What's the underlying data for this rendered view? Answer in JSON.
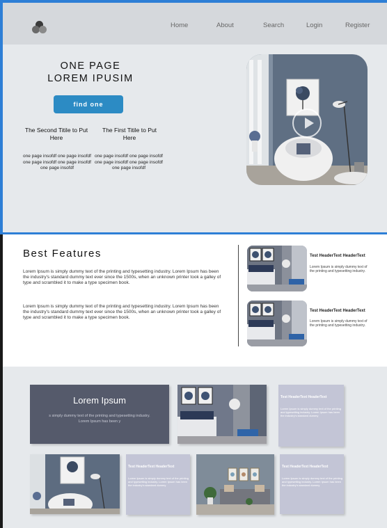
{
  "nav": {
    "items": [
      {
        "label": "Home"
      },
      {
        "label": "About"
      },
      {
        "label": "Search"
      },
      {
        "label": "Login"
      },
      {
        "label": "Register"
      }
    ]
  },
  "hero": {
    "title_line1": "ONE PAGE",
    "title_line2": "LOREM IPUSIM",
    "button_label": "find one",
    "columns": [
      {
        "title": "The Second Titile to Put Here",
        "text": "one page insofdf one page insofdf one page insofdf one page insofdf one page insofdf"
      },
      {
        "title": "The First Titile to Put Here",
        "text": "one page insofdf one page insofdf one page insofdf one page insofdf one page insofdf"
      }
    ]
  },
  "features": {
    "title": "Best Features",
    "paragraphs": [
      "Lorem Ipsum is simply dummy text of the printing and typesetting industry. Lorem Ipsum has been the industry's standard dummy text ever since the 1500s, when an unknown printer took a galley of type and scrambled it to make a type specimen book.",
      "Lorem Ipsum is simply dummy text of the printing and typesetting industry. Lorem Ipsum has been the industry's standard dummy text ever since the 1500s, when an unknown printer took a galley of type and scrambled it to make a type specimen book."
    ],
    "cards": [
      {
        "title": "Test HeaderText HeaderText",
        "text": "Lorem Ipsum is simply dummy text of the printing and typesetting industry."
      },
      {
        "title": "Test HeaderText HeaderText",
        "text": "Lorem Ipsum is simply dummy text of the printing and typesetting industry."
      }
    ]
  },
  "gallery": {
    "feature_title": "Lorem Ipsum",
    "feature_text": "s simply dummy text of the printing and typesetting industry. Lorem Ipsum has been y",
    "tiles": [
      {
        "title": "Test HeaderText HeaderText",
        "text": "Lorem Ipsum is simply dummy text of the printing and typesetting industry. Lorem Ipsum has been the industry's standard dummy"
      },
      {
        "title": "Test HeaderText HeaderText",
        "text": "Lorem Ipsum is simply dummy text of the printing and typesetting industry. Lorem Ipsum has been the industry's standard dummy"
      },
      {
        "title": "Test HeaderText HeaderText",
        "text": "Lorem Ipsum is simply dummy text of the printing and typesetting industry. Lorem Ipsum has been the industry's standard dummy"
      }
    ]
  },
  "colors": {
    "accent": "#2c8bc4",
    "header_bg": "#d5d8dc",
    "hero_bg": "#e6e9ec",
    "tile_dark": "#555a6b",
    "tile_lavender": "#c3c5d6"
  }
}
